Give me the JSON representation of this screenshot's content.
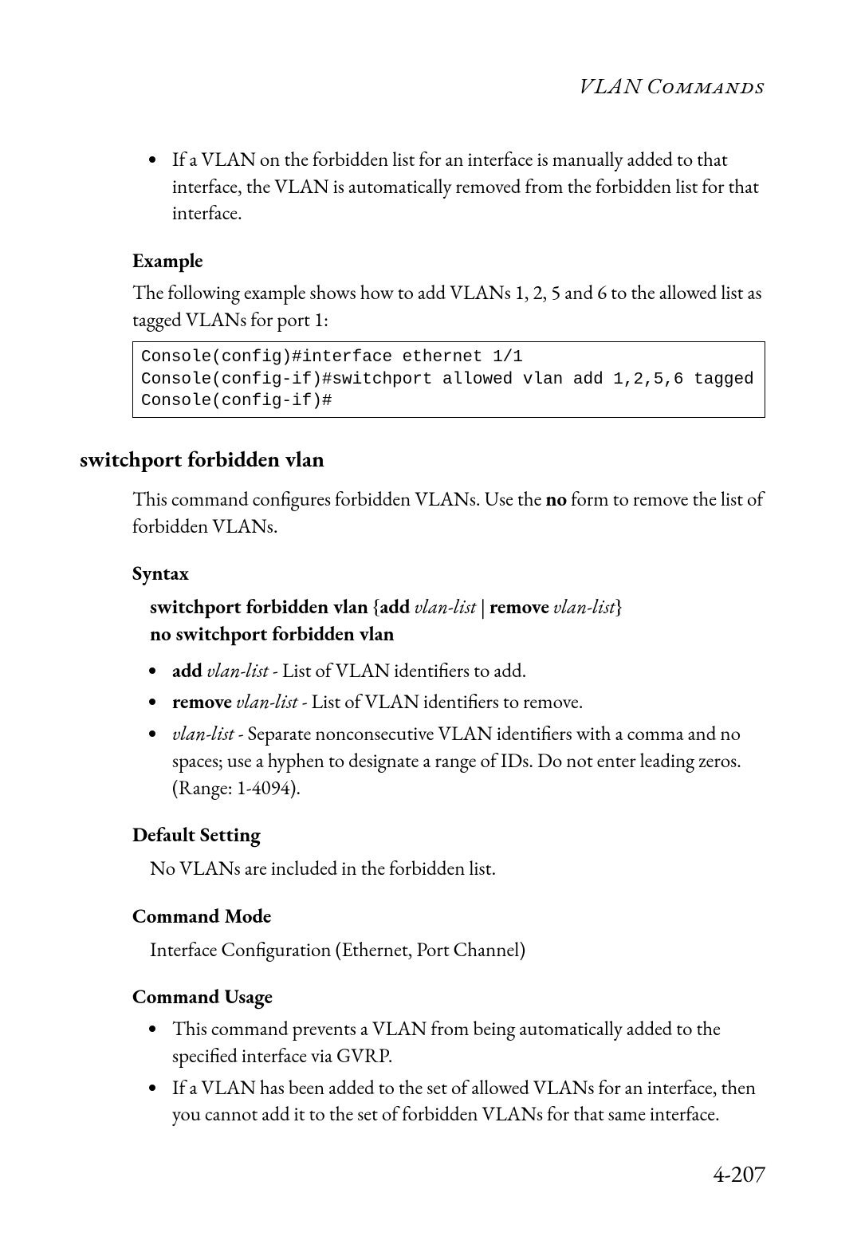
{
  "header": {
    "title": "VLAN Commands"
  },
  "topBullet": "If a VLAN on the forbidden list for an interface is manually added to that interface, the VLAN is automatically removed from the forbidden list for that interface.",
  "example": {
    "heading": "Example",
    "text": "The following example shows how to add VLANs 1, 2, 5 and 6 to the allowed list as tagged VLANs for port 1:",
    "code": "Console(config)#interface ethernet 1/1\nConsole(config-if)#switchport allowed vlan add 1,2,5,6 tagged\nConsole(config-if)#"
  },
  "section": {
    "title": "switchport forbidden vlan",
    "description": {
      "pre": "This command configures forbidden VLANs. Use the ",
      "bold": "no",
      "post": " form to remove the list of forbidden VLANs."
    },
    "syntax": {
      "heading": "Syntax",
      "line1": {
        "p1": "switchport forbidden vlan",
        "p2": " {",
        "p3": "add",
        "p4": " ",
        "p5": "vlan-list",
        "p6": " | ",
        "p7": "remove",
        "p8": " ",
        "p9": "vlan-list",
        "p10": "}"
      },
      "line2": "no switchport forbidden vlan",
      "bullets": {
        "b1": {
          "bold": "add",
          "ital": " vlan-list",
          "rest": " - List of VLAN identifiers to add."
        },
        "b2": {
          "bold": "remove",
          "ital": " vlan-list",
          "rest": " - List of VLAN identifiers to remove."
        },
        "b3": {
          "ital": "vlan-list",
          "rest": " - Separate nonconsecutive VLAN identifiers with a comma and no spaces; use a hyphen to designate a range of IDs. Do not enter leading zeros. (Range: 1-4094)."
        }
      }
    },
    "defaultSetting": {
      "heading": "Default Setting",
      "text": "No VLANs are included in the forbidden list."
    },
    "commandMode": {
      "heading": "Command Mode",
      "text": "Interface Configuration (Ethernet, Port Channel)"
    },
    "commandUsage": {
      "heading": "Command Usage",
      "b1": "This command prevents a VLAN from being automatically added to the specified interface via GVRP.",
      "b2": "If a VLAN has been added to the set of allowed VLANs for an interface, then you cannot add it to the set of forbidden VLANs for that same interface."
    }
  },
  "pageNumber": "4-207"
}
